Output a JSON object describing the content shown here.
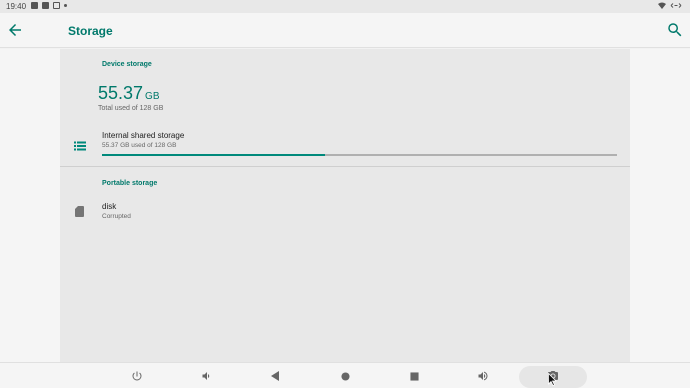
{
  "status_bar": {
    "time": "19:40",
    "icons": [
      "calendar-icon",
      "sd-card-icon",
      "image-icon",
      "notification-dot-icon"
    ],
    "right_icons": [
      "wifi-icon",
      "ethernet-icon"
    ]
  },
  "app_bar": {
    "title": "Storage",
    "back_icon": "arrow-back-icon",
    "search_icon": "search-icon"
  },
  "device_storage": {
    "header": "Device storage",
    "used_value": "55.37",
    "used_unit": "GB",
    "total_text": "Total used of 128 GB",
    "internal": {
      "title": "Internal shared storage",
      "subtitle": "55.37 GB used of 128 GB",
      "icon": "storage-list-icon",
      "progress_fraction": 0.4326
    }
  },
  "portable_storage": {
    "header": "Portable storage",
    "items": [
      {
        "title": "disk",
        "subtitle": "Corrupted",
        "icon": "sd-card-icon"
      }
    ]
  },
  "nav_bar": {
    "buttons": [
      "power-icon",
      "volume-down-icon",
      "back-triangle-icon",
      "home-circle-icon",
      "recents-square-icon",
      "volume-up-icon",
      "screenshot-icon"
    ]
  },
  "colors": {
    "accent": "#00796b",
    "progress": "#00897b",
    "content_bg": "#e8e8e8"
  }
}
